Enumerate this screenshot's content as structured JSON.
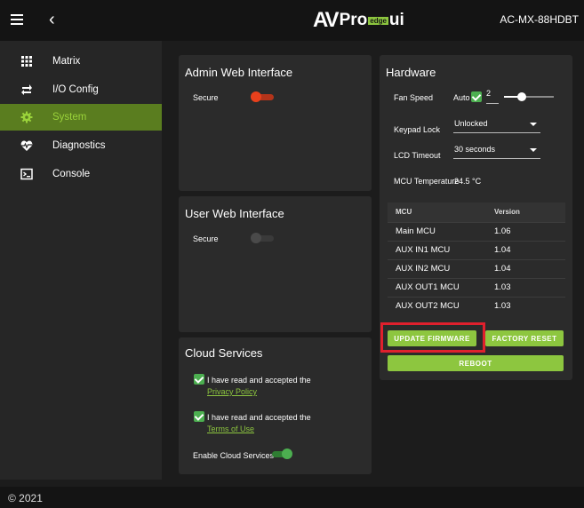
{
  "header": {
    "logo_av": "AV",
    "logo_pro": "Pro",
    "logo_edge": "edge",
    "logo_ui": "ui",
    "device": "AC-MX-88HDBT"
  },
  "sidebar": {
    "items": [
      {
        "label": "Matrix",
        "icon": "grid-icon"
      },
      {
        "label": "I/O Config",
        "icon": "arrows-icon"
      },
      {
        "label": "System",
        "icon": "gear-icon",
        "active": true
      },
      {
        "label": "Diagnostics",
        "icon": "heartbeat-icon"
      },
      {
        "label": "Console",
        "icon": "terminal-icon"
      }
    ]
  },
  "admin": {
    "title": "Admin Web Interface",
    "secure_label": "Secure",
    "secure_on": true
  },
  "user": {
    "title": "User Web Interface",
    "secure_label": "Secure",
    "secure_on": false
  },
  "cloud": {
    "title": "Cloud Services",
    "privacy_text": "I have read and accepted the",
    "privacy_link": "Privacy Policy",
    "terms_text": "I have read and accepted the",
    "terms_link": "Terms of Use",
    "enable_label": "Enable Cloud Services",
    "enable_on": true
  },
  "hardware": {
    "title": "Hardware",
    "fan_speed_label": "Fan Speed",
    "fan_auto_label": "Auto",
    "fan_auto_checked": true,
    "fan_value": "2",
    "fan_slider_level": 0.35,
    "keypad_label": "Keypad Lock",
    "keypad_value": "Unlocked",
    "lcd_label": "LCD Timeout",
    "lcd_value": "30 seconds",
    "mcu_temp_label": "MCU Temperature",
    "mcu_temp_value": "24.5 °C",
    "mcu_table": {
      "headers": [
        "MCU",
        "Version"
      ],
      "rows": [
        [
          "Main MCU",
          "1.06"
        ],
        [
          "AUX IN1 MCU",
          "1.04"
        ],
        [
          "AUX IN2 MCU",
          "1.04"
        ],
        [
          "AUX OUT1 MCU",
          "1.03"
        ],
        [
          "AUX OUT2 MCU",
          "1.03"
        ]
      ]
    },
    "update_label": "UPDATE FIRMWARE",
    "factory_label": "FACTORY RESET",
    "reboot_label": "REBOOT"
  },
  "footer": {
    "copyright": "© 2021"
  },
  "colors": {
    "accent": "#8dc63f",
    "toggle_on_admin": "#e8401c",
    "toggle_on_cloud": "#4caf50",
    "highlight": "#e0202d"
  }
}
